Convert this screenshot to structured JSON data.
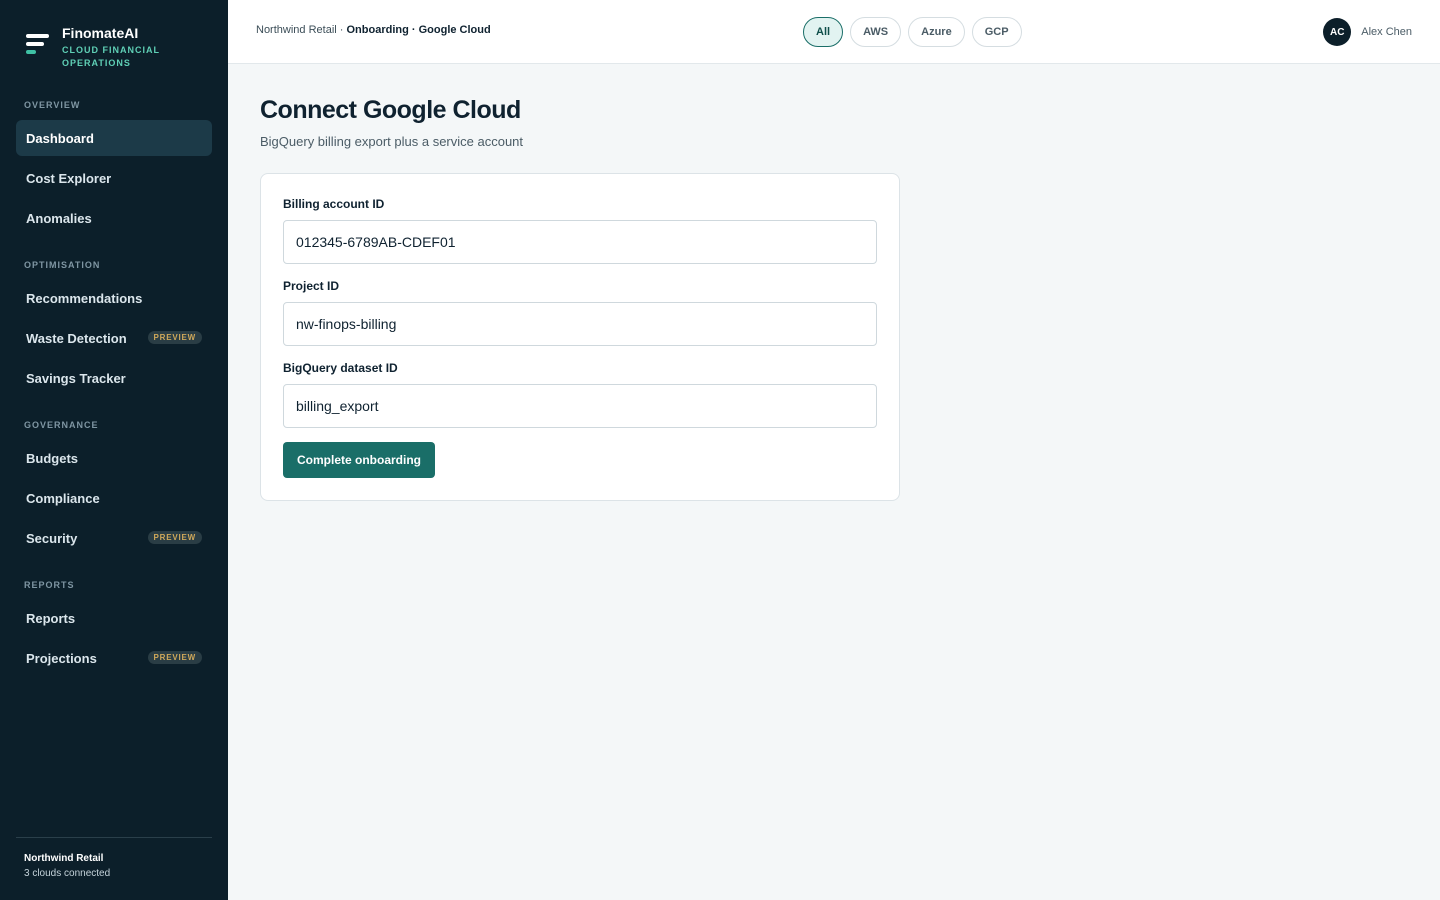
{
  "brand": {
    "name": "FinomateAI",
    "tagline": "CLOUD FINANCIAL OPERATIONS"
  },
  "sidebar": {
    "sections": [
      {
        "title": "OVERVIEW",
        "items": [
          {
            "label": "Dashboard",
            "active": true
          },
          {
            "label": "Cost Explorer"
          },
          {
            "label": "Anomalies"
          }
        ]
      },
      {
        "title": "OPTIMISATION",
        "items": [
          {
            "label": "Recommendations"
          },
          {
            "label": "Waste Detection",
            "badge": "PREVIEW"
          },
          {
            "label": "Savings Tracker"
          }
        ]
      },
      {
        "title": "GOVERNANCE",
        "items": [
          {
            "label": "Budgets"
          },
          {
            "label": "Compliance"
          },
          {
            "label": "Security",
            "badge": "PREVIEW"
          }
        ]
      },
      {
        "title": "REPORTS",
        "items": [
          {
            "label": "Reports"
          },
          {
            "label": "Projections",
            "badge": "PREVIEW"
          }
        ]
      }
    ],
    "footer": {
      "org": "Northwind Retail",
      "status": "3 clouds connected"
    }
  },
  "header": {
    "breadcrumb": {
      "org": "Northwind Retail",
      "separator": "·",
      "section": "Onboarding · Google Cloud"
    },
    "cloud_filters": [
      {
        "label": "All",
        "active": true
      },
      {
        "label": "AWS"
      },
      {
        "label": "Azure"
      },
      {
        "label": "GCP"
      }
    ],
    "user": {
      "initials": "AC",
      "name": "Alex Chen"
    }
  },
  "main": {
    "title": "Connect Google Cloud",
    "subtitle": "BigQuery billing export plus a service account",
    "fields": [
      {
        "label": "Billing account ID",
        "value": "012345-6789AB-CDEF01"
      },
      {
        "label": "Project ID",
        "value": "nw-finops-billing"
      },
      {
        "label": "BigQuery dataset ID",
        "value": "billing_export"
      }
    ],
    "submit_label": "Complete onboarding"
  },
  "colors": {
    "sidebar_bg": "#0c1f2a",
    "accent": "#1a6e68",
    "brand_accent": "#3fc1a5",
    "badge_text": "#cfa85a"
  }
}
